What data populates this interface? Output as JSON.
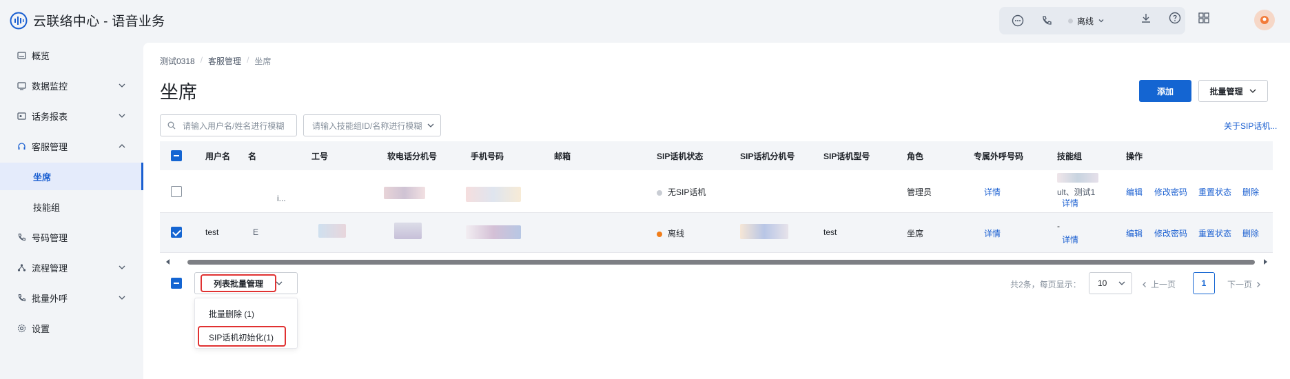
{
  "app": {
    "title": "云联络中心 - 语音业务"
  },
  "topbar": {
    "status_label": "离线",
    "icons": [
      "chat-icon",
      "phone-icon",
      "download-icon",
      "help-icon",
      "grid-icon",
      "avatar"
    ]
  },
  "sidebar": {
    "items": [
      {
        "label": "概览",
        "icon": "overview-icon"
      },
      {
        "label": "数据监控",
        "icon": "monitor-icon"
      },
      {
        "label": "话务报表",
        "icon": "report-icon"
      },
      {
        "label": "客服管理",
        "icon": "headset-icon"
      },
      {
        "label": "坐席",
        "icon": ""
      },
      {
        "label": "技能组",
        "icon": ""
      },
      {
        "label": "号码管理",
        "icon": "phone-icon"
      },
      {
        "label": "流程管理",
        "icon": "flow-icon"
      },
      {
        "label": "批量外呼",
        "icon": "outbound-icon"
      },
      {
        "label": "设置",
        "icon": "gear-icon"
      }
    ],
    "active": "坐席"
  },
  "breadcrumb": [
    "测试0318",
    "客服管理",
    "坐席"
  ],
  "page": {
    "title": "坐席",
    "add_label": "添加",
    "batch_label": "批量管理",
    "about_link": "关于SIP话机..."
  },
  "filters": {
    "search_placeholder": "请输入用户名/姓名进行模糊",
    "skill_placeholder": "请输入技能组ID/名称进行模糊"
  },
  "table": {
    "columns": [
      "用户名",
      "名",
      "工号",
      "软电话分机号",
      "手机号码",
      "邮箱",
      "SIP话机状态",
      "SIP话机分机号",
      "SIP话机型号",
      "角色",
      "专属外呼号码",
      "技能组",
      "操作"
    ],
    "rows": [
      {
        "username": "",
        "name_fragment": "i...",
        "sip_status": "无SIP话机",
        "sip_status_color": "#c9cdd4",
        "sip_ext": "",
        "sip_model": "",
        "role": "管理员",
        "exclusive_number": "详情",
        "skill_group": "ult、测试1",
        "skill_detail": "详情",
        "actions": [
          "编辑",
          "修改密码",
          "重置状态",
          "删除"
        ],
        "selected": false
      },
      {
        "username": "test",
        "name_fragment": "E",
        "sip_status": "离线",
        "sip_status_color": "#f07d1a",
        "sip_ext": "",
        "sip_model": "test",
        "role": "坐席",
        "exclusive_number": "详情",
        "skill_group": "-",
        "skill_detail": "详情",
        "actions": [
          "编辑",
          "修改密码",
          "重置状态",
          "删除"
        ],
        "selected": true
      }
    ]
  },
  "bulk": {
    "label": "列表批量管理",
    "options": [
      "批量删除 (1)",
      "SIP话机初始化(1)"
    ]
  },
  "pager": {
    "total_text": "共2条，每页显示：",
    "page_size": "10",
    "prev": "上一页",
    "current": "1",
    "next": "下一页"
  },
  "colors": {
    "primary": "#1465d2",
    "highlight": "#e03131"
  }
}
